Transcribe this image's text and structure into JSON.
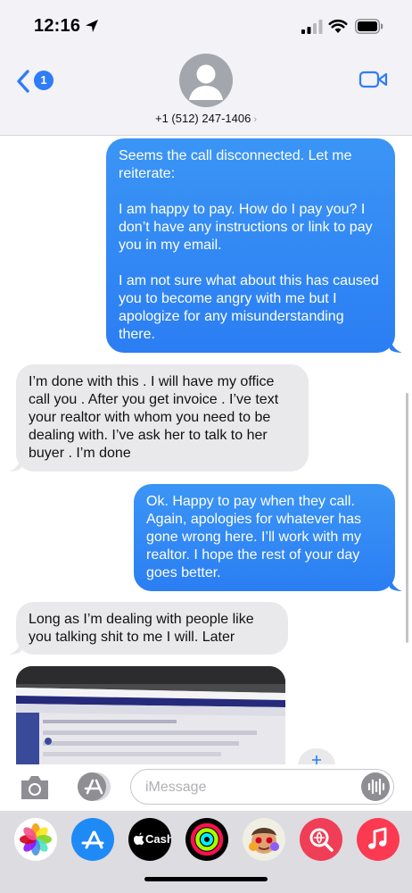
{
  "status_bar": {
    "time": "12:16"
  },
  "header": {
    "unread_count": "1",
    "contact": "+1 (512) 247-1406",
    "contact_chevron": "›"
  },
  "messages": [
    {
      "direction": "sent",
      "text": "Seems the call disconnected. Let me reiterate:\n\nI am happy to pay. How do I pay you? I don’t have any instructions or link to pay you in my email.\n\nI am not sure what about this has caused you to become angry with me but I apologize for any misunderstanding there."
    },
    {
      "direction": "received",
      "text": "I’m done with this . I will have my office call you . After you get invoice . I’ve text your realtor with whom you need to be dealing with. I’ve ask her to talk to her buyer . I’m done"
    },
    {
      "direction": "sent",
      "text": "Ok. Happy to pay when they call. Again, apologies for whatever has gone wrong here. I’ll work with my realtor. I hope the rest of your day goes better."
    },
    {
      "direction": "received",
      "text": "Long as I’m dealing with people like you talking shit to me I will.  Later"
    }
  ],
  "input": {
    "placeholder": "iMessage"
  },
  "app_drawer": {
    "cash_label": "Cash",
    "apps": [
      "photos-icon",
      "app-store-icon",
      "apple-cash-icon",
      "activity-icon",
      "memoji-icon",
      "image-search-icon",
      "music-icon"
    ]
  },
  "colors": {
    "sent_bubble": "#2b7ef3",
    "received_bubble": "#e9e9eb",
    "accent": "#2f7cf6"
  }
}
